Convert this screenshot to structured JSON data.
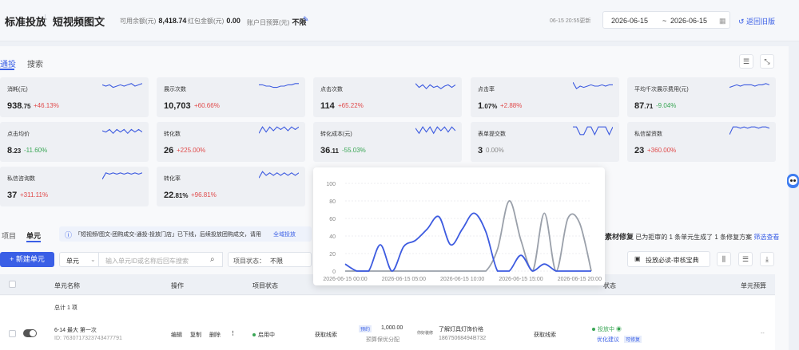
{
  "header": {
    "title": "标准投放",
    "content_type": "短视频图文",
    "balance_label": "可用余额(元)",
    "balance_value": "8,418.74",
    "redpack_label": "红包金额(元)",
    "redpack_value": "0.00",
    "daily_budget_label": "账户日预算(元)",
    "daily_budget_value": "不限",
    "update_time": "06-15 20:55更新",
    "date_start": "2026-06-15",
    "date_sep": "~",
    "date_end": "2026-06-15",
    "back_label": "返回旧版"
  },
  "tabs": [
    "通投",
    "搜索"
  ],
  "metrics": [
    {
      "label": "消耗(元)",
      "value_main": "938",
      "value_decimal": ".75",
      "change": "+46.13%",
      "trend": "up",
      "spark": [
        6,
        5,
        6,
        4,
        5,
        6,
        5,
        6,
        7,
        5,
        6,
        7
      ]
    },
    {
      "label": "展示次数",
      "value_main": "10,703",
      "value_decimal": "",
      "change": "+60.66%",
      "trend": "up",
      "spark": [
        6,
        6,
        5,
        5,
        4,
        4,
        5,
        5,
        6,
        6,
        7,
        7
      ]
    },
    {
      "label": "点击次数",
      "value_main": "114",
      "value_decimal": "",
      "change": "+65.22%",
      "trend": "up",
      "spark": [
        7,
        4,
        6,
        3,
        6,
        4,
        5,
        3,
        5,
        6,
        4,
        6
      ]
    },
    {
      "label": "点击率",
      "value_main": "1",
      "value_decimal": ".07%",
      "change": "+2.88%",
      "trend": "up",
      "spark": [
        8,
        3,
        5,
        4,
        5,
        6,
        5,
        5,
        6,
        5,
        6,
        6
      ]
    },
    {
      "label": "平均千次展示费用(元)",
      "value_main": "87",
      "value_decimal": ".71",
      "change": "-9.04%",
      "trend": "down",
      "spark": [
        4,
        5,
        6,
        5,
        6,
        6,
        6,
        5,
        6,
        6,
        7,
        6
      ]
    },
    {
      "label": "点击均价",
      "value_main": "8",
      "value_decimal": ".23",
      "change": "-11.60%",
      "trend": "down",
      "spark": [
        5,
        4,
        6,
        3,
        6,
        4,
        6,
        3,
        6,
        4,
        6,
        4
      ]
    },
    {
      "label": "转化数",
      "value_main": "26",
      "value_decimal": "",
      "change": "+225.00%",
      "trend": "up",
      "spark": [
        3,
        8,
        4,
        8,
        5,
        8,
        6,
        8,
        5,
        8,
        6,
        8
      ]
    },
    {
      "label": "转化成本(元)",
      "value_main": "36",
      "value_decimal": ".11",
      "change": "-55.03%",
      "trend": "down",
      "spark": [
        7,
        3,
        8,
        4,
        8,
        3,
        8,
        5,
        8,
        4,
        8,
        5
      ]
    },
    {
      "label": "表单提交数",
      "value_main": "3",
      "value_decimal": "",
      "change": "0.00%",
      "trend": "flat",
      "spark": [
        8,
        8,
        2,
        2,
        8,
        8,
        2,
        8,
        8,
        8,
        2,
        8
      ]
    },
    {
      "label": "私信留资数",
      "value_main": "23",
      "value_decimal": "",
      "change": "+360.00%",
      "trend": "up",
      "spark": [
        2,
        8,
        8,
        7,
        8,
        7,
        8,
        8,
        7,
        8,
        8,
        7
      ]
    },
    {
      "label": "私信咨询数",
      "value_main": "37",
      "value_decimal": "",
      "change": "+311.11%",
      "trend": "up",
      "spark": [
        2,
        7,
        6,
        7,
        6,
        7,
        6,
        7,
        6,
        7,
        6,
        7
      ]
    },
    {
      "label": "转化率",
      "value_main": "22",
      "value_decimal": ".81%",
      "change": "+96.81%",
      "trend": "up",
      "spark": [
        3,
        8,
        5,
        7,
        5,
        7,
        5,
        7,
        5,
        7,
        5,
        7
      ]
    }
  ],
  "chart_data": {
    "type": "line",
    "x": [
      "2026-06-15 00:00",
      "2026-06-15 05:00",
      "2026-06-15 10:00",
      "2026-06-15 15:00",
      "2026-06-15 20:00"
    ],
    "x_hours": [
      0,
      1,
      2,
      3,
      4,
      5,
      6,
      7,
      8,
      9,
      10,
      11,
      12,
      13,
      14,
      15,
      16,
      17,
      18,
      19,
      20,
      21
    ],
    "ylim": [
      0,
      100
    ],
    "yticks": [
      0,
      20,
      40,
      60,
      80,
      100
    ],
    "series": [
      {
        "color": "#3d5be0",
        "values": [
          8,
          0,
          0,
          30,
          0,
          28,
          35,
          48,
          62,
          30,
          48,
          66,
          45,
          0,
          0,
          18,
          0,
          8,
          0,
          0,
          0,
          0
        ]
      },
      {
        "color": "#9aa0aa",
        "values": [
          0,
          0,
          0,
          0,
          0,
          0,
          0,
          0,
          0,
          0,
          0,
          0,
          0,
          25,
          80,
          35,
          0,
          66,
          0,
          60,
          55,
          0
        ]
      }
    ]
  },
  "bottom_tabs": [
    "项目",
    "单元"
  ],
  "notice": {
    "text": "「短视频/图文-团购成交-通投-投放门店」已下线，后续投放团购成交，请用",
    "link": "全域投放"
  },
  "fix": {
    "title": "素材修复",
    "text_a": "已为拒审的",
    "count_a": "1",
    "text_b": "条单元生成了",
    "count_b": "1",
    "text_c": "条修复方案",
    "link": "筛选查看"
  },
  "toolbar": {
    "new_unit": "+ 新建单元",
    "select_value": "单元",
    "search_placeholder": "输入单元ID或名称后回车搜索",
    "status_label": "项目状态：",
    "status_value": "不限",
    "guide_button": "投放必读-审核宝典"
  },
  "table": {
    "headers": {
      "name": "单元名称",
      "action": "操作",
      "project_status": "项目状态",
      "status": "状态",
      "budget": "单元预算"
    },
    "total": "总计 1 项",
    "row": {
      "name": "6-14 最大 第一次",
      "id": "ID: 7630717323743477791",
      "actions": [
        "编辑",
        "复制",
        "删除"
      ],
      "more": "⋮",
      "project_status": "启用中",
      "goal": "获取线索",
      "budget_badge": "预约",
      "budget_value": "1,000.00",
      "budget_sub": "预算保优分配",
      "product_logo": "你好装修",
      "product_title": "了解灯具灯饰价格",
      "product_phone": "18675068494B732",
      "goal2": "获取线索",
      "status_text": "投放中",
      "badge": "优化建议",
      "badge2": "可修复",
      "budget_cell": "--"
    }
  }
}
